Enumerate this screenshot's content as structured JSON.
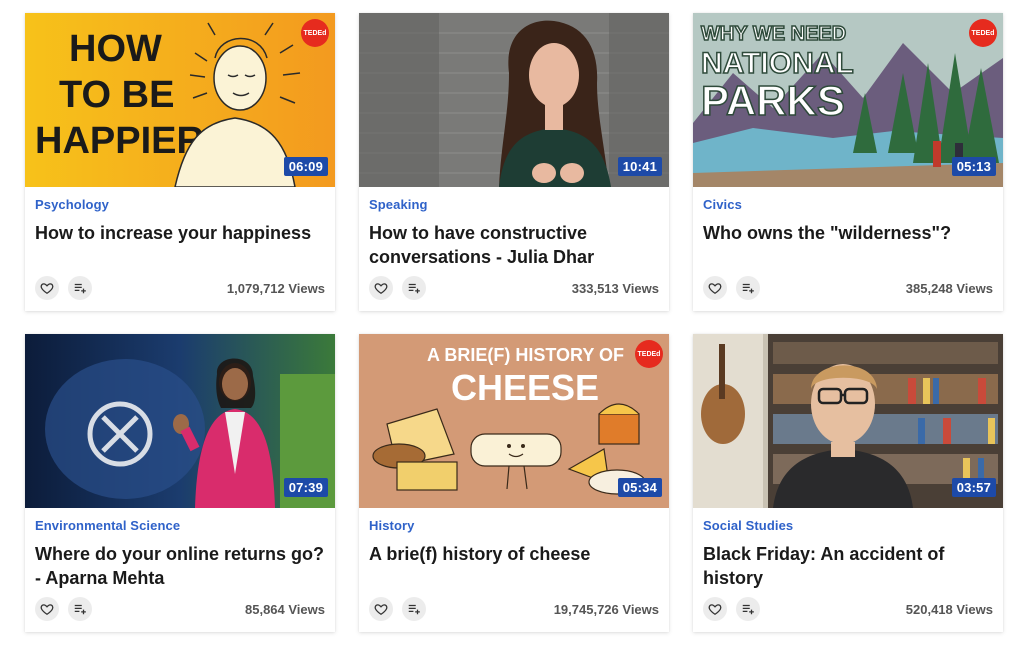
{
  "badge_label": "TEDEd",
  "colors": {
    "category": "#2f62c9",
    "duration_bg": "#1d4aa8",
    "ted_red": "#e62b1e"
  },
  "cards": [
    {
      "category": "Psychology",
      "title": "How to increase your happiness",
      "views": "1,079,712 Views",
      "duration": "06:09",
      "thumb_text": [
        "HOW",
        "TO BE",
        "HAPPIER"
      ]
    },
    {
      "category": "Speaking",
      "title": "How to have constructive conversations - Julia Dhar",
      "views": "333,513 Views",
      "duration": "10:41"
    },
    {
      "category": "Civics",
      "title": "Who owns the \"wilderness\"?",
      "views": "385,248 Views",
      "duration": "05:13",
      "thumb_text": [
        "WHY WE NEED",
        "NATIONAL",
        "PARKS"
      ]
    },
    {
      "category": "Environmental Science",
      "title": "Where do your online returns go? - Aparna Mehta",
      "views": "85,864 Views",
      "duration": "07:39"
    },
    {
      "category": "History",
      "title": "A brie(f) history of cheese",
      "views": "19,745,726 Views",
      "duration": "05:34",
      "thumb_text": [
        "A BRIE(F) HISTORY OF",
        "CHEESE"
      ]
    },
    {
      "category": "Social Studies",
      "title": "Black Friday: An accident of history",
      "views": "520,418 Views",
      "duration": "03:57"
    }
  ],
  "icons": {
    "like": "heart-icon",
    "add_to_list": "playlist-add-icon"
  }
}
